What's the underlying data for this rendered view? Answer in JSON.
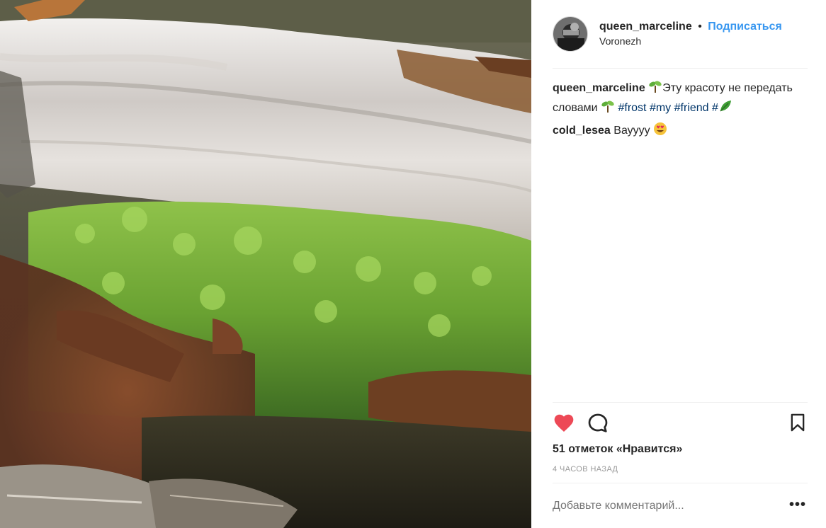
{
  "post": {
    "username": "queen_marceline",
    "separator": "•",
    "follow_label": "Подписаться",
    "location": "Voronezh"
  },
  "caption": {
    "username": "queen_marceline",
    "text_part1": "Эту красоту не передать словами",
    "hashtags": [
      "#frost",
      "#my",
      "#friend",
      "#"
    ]
  },
  "comments": [
    {
      "username": "cold_lesea",
      "text": "Вауууу"
    }
  ],
  "stats": {
    "likes_label": "51 отметок «Нравится»",
    "time_label": "4 ЧАСОВ НАЗАД"
  },
  "comment_box": {
    "placeholder": "Добавьте комментарий...",
    "more_label": "•••"
  },
  "icons": {
    "like": "heart-icon",
    "comment": "comment-bubble-icon",
    "save": "bookmark-icon",
    "more": "ellipsis-icon"
  },
  "colors": {
    "like_red": "#ed4956",
    "follow_blue": "#3897f0",
    "hashtag": "#003569"
  }
}
